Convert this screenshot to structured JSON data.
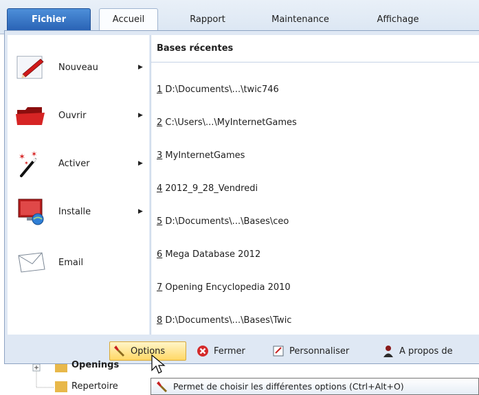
{
  "tabs": {
    "file": "Fichier",
    "items": [
      "Accueil",
      "Rapport",
      "Maintenance",
      "Affichage"
    ]
  },
  "menu": [
    {
      "label": "Nouveau",
      "icon": "pen-icon",
      "submenu": true
    },
    {
      "label": "Ouvrir",
      "icon": "folder-icon",
      "submenu": true
    },
    {
      "label": "Activer",
      "icon": "magic-wand-icon",
      "submenu": true
    },
    {
      "label": "Installe",
      "icon": "computer-install-icon",
      "submenu": true
    },
    {
      "label": "Email",
      "icon": "envelope-icon",
      "submenu": false
    }
  ],
  "recent": {
    "header": "Bases récentes",
    "items": [
      {
        "num": "1",
        "text": " D:\\Documents\\...\\twic746"
      },
      {
        "num": "2",
        "text": " C:\\Users\\...\\MyInternetGames"
      },
      {
        "num": "3",
        "text": " MyInternetGames"
      },
      {
        "num": "4",
        "text": " 2012_9_28_Vendredi"
      },
      {
        "num": "5",
        "text": " D:\\Documents\\...\\Bases\\ceo"
      },
      {
        "num": "6",
        "text": " Mega Database 2012"
      },
      {
        "num": "7",
        "text": " Opening Encyclopedia 2010"
      },
      {
        "num": "8",
        "text": " D:\\Documents\\...\\Bases\\Twic"
      }
    ]
  },
  "bottom": {
    "options": "Options",
    "close": "Fermer",
    "customize": "Personnaliser",
    "about": "A propos de"
  },
  "tree": {
    "openings": "Openings",
    "repertoire": "Repertoire"
  },
  "tooltip": "Permet de choisir les différentes options (Ctrl+Alt+O)",
  "colors": {
    "file_tab": "#2a63b5",
    "hover": "#ffd866",
    "frame": "#dfe8f4"
  }
}
